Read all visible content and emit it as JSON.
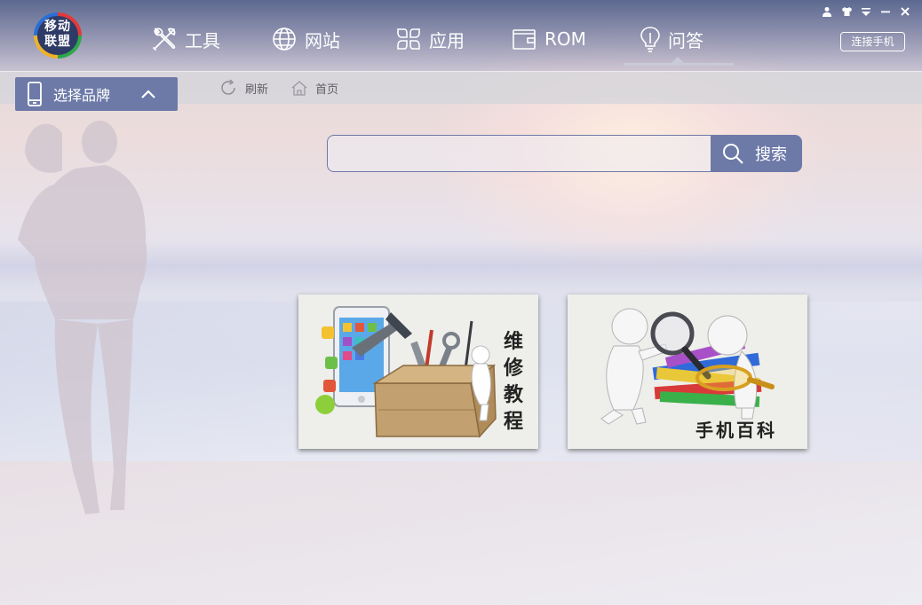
{
  "logo": {
    "line1": "移动",
    "line2": "联盟"
  },
  "nav": {
    "tools": {
      "label": "工具",
      "icon": "tools-icon"
    },
    "sites": {
      "label": "网站",
      "icon": "globe-icon"
    },
    "apps": {
      "label": "应用",
      "icon": "apps-icon"
    },
    "rom": {
      "label": "ROM",
      "icon": "wallet-icon"
    },
    "qa": {
      "label": "问答",
      "icon": "lightbulb-icon"
    },
    "active": "qa"
  },
  "window_controls": {
    "user": "user-icon",
    "skin": "shirt-icon",
    "menu": "menu-icon",
    "minimize": "minimize-icon",
    "close": "close-icon"
  },
  "connect_button": {
    "label": "连接手机"
  },
  "brand_select": {
    "label": "选择品牌",
    "icon": "phone-icon",
    "chevron": "chevron-up-icon"
  },
  "toolbar": {
    "refresh": {
      "label": "刷新",
      "icon": "refresh-icon"
    },
    "home": {
      "label": "首页",
      "icon": "home-icon"
    }
  },
  "search": {
    "value": "",
    "placeholder": "",
    "button_label": "搜索",
    "icon": "search-icon"
  },
  "cards": {
    "repair": {
      "title_chars": [
        "维",
        "修",
        "教",
        "程"
      ]
    },
    "wiki": {
      "title": "手机百科"
    }
  },
  "colors": {
    "accent": "#6d7aa8",
    "topbar": "#4a5888",
    "subbar": "#d6d6da"
  }
}
